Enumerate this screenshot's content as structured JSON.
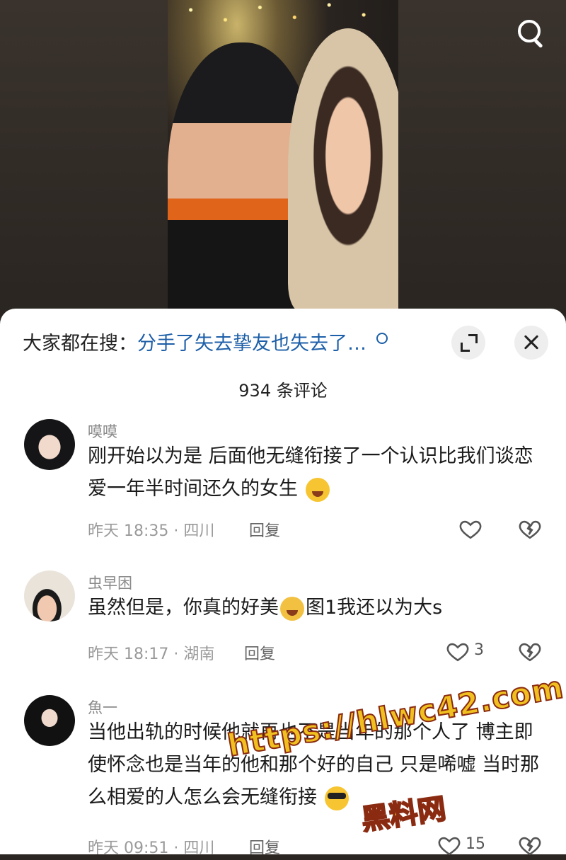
{
  "trending": {
    "prefix": "大家都在搜：",
    "query": "分手了失去挚友也失去了…"
  },
  "comments_header": {
    "count_label": "934 条评论"
  },
  "comments": [
    {
      "user": "嗼嗼",
      "text": "刚开始以为是 后面他无缝衔接了一个认识比我们谈恋爱一年半时间还久的女生",
      "emoji": "laughing-face",
      "time": "昨天 18:35 · 四川",
      "reply_label": "回复",
      "likes": ""
    },
    {
      "user": "虫早困",
      "text_before": "虽然但是，你真的好美",
      "emoji": "crying-face",
      "text_after": "图1我还以为大s",
      "time": "昨天 18:17 · 湖南",
      "reply_label": "回复",
      "likes": "3"
    },
    {
      "user": "魚一",
      "text": "当他出轨的时候他就再也不是当年的那个人了 博主即使怀念也是当年的他和那个好的自己 只是唏嘘 当时那么相爱的人怎么会无缝衔接",
      "emoji": "sunglasses-crying-face",
      "time": "昨天 09:51 · 四川",
      "reply_label": "回复",
      "likes": "15"
    }
  ],
  "watermark": {
    "url": "https://hlwc42.com",
    "name": "黑料网"
  }
}
